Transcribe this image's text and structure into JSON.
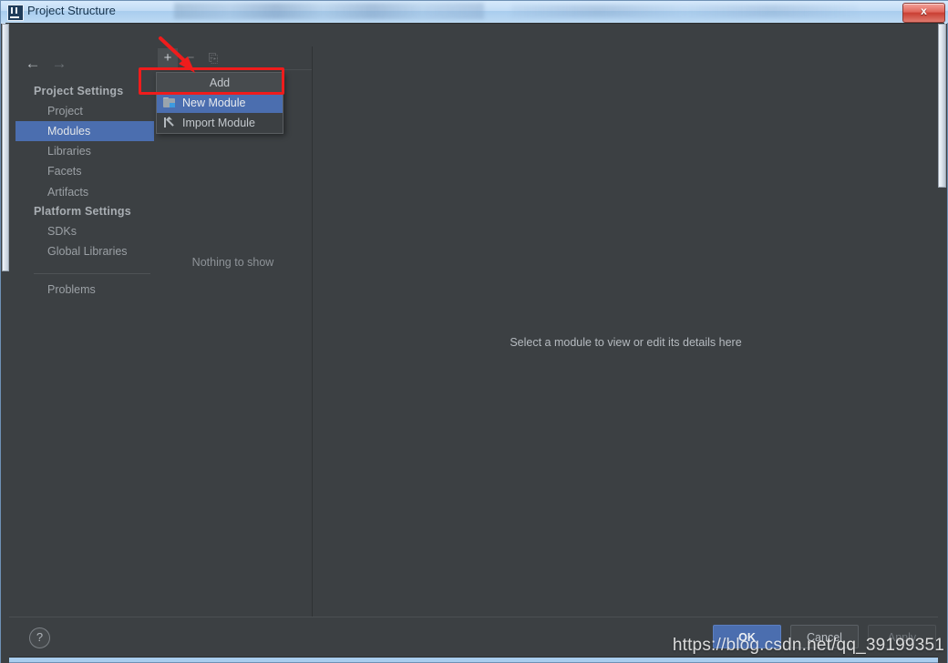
{
  "window": {
    "title": "Project Structure",
    "icon": "intellij-idea-icon",
    "close_label": "x"
  },
  "nav": {
    "back_icon": "arrow-left-icon",
    "forward_icon": "arrow-right-icon"
  },
  "sidebar": {
    "groups": [
      {
        "label": "Project Settings",
        "items": [
          {
            "label": "Project",
            "selected": false
          },
          {
            "label": "Modules",
            "selected": true
          },
          {
            "label": "Libraries",
            "selected": false
          },
          {
            "label": "Facets",
            "selected": false
          },
          {
            "label": "Artifacts",
            "selected": false
          }
        ]
      },
      {
        "label": "Platform Settings",
        "items": [
          {
            "label": "SDKs",
            "selected": false
          },
          {
            "label": "Global Libraries",
            "selected": false
          }
        ]
      }
    ],
    "extra_items": [
      {
        "label": "Problems",
        "selected": false
      }
    ]
  },
  "middle_panel": {
    "toolbar": {
      "add_icon": "plus-icon",
      "add_label": "+",
      "remove_icon": "minus-icon",
      "remove_label": "−",
      "copy_icon": "copy-icon",
      "copy_label": "⎘"
    },
    "empty_text": "Nothing to show"
  },
  "popup_menu": {
    "header": "Add",
    "items": [
      {
        "label": "New Module",
        "icon": "folder-module-icon",
        "highlighted": true
      },
      {
        "label": "Import Module",
        "icon": "import-arrow-icon",
        "highlighted": false
      }
    ]
  },
  "detail_panel": {
    "placeholder": "Select a module to view or edit its details here"
  },
  "footer": {
    "help_label": "?",
    "help_icon": "question-mark-icon",
    "ok_label": "OK",
    "cancel_label": "Cancel",
    "apply_label": "Apply"
  },
  "annotations": {
    "highlight_target": "New Module",
    "arrow_color": "#ef1c1c",
    "rect_color": "#ef1c1c"
  },
  "watermark": {
    "text": "https://blog.csdn.net/qq_39199351"
  },
  "colors": {
    "background": "#3c4043",
    "selection": "#4b6eaf",
    "accent_red": "#ef1c1c",
    "text_primary": "#b6bbc0",
    "text_dim": "#8e9398"
  }
}
